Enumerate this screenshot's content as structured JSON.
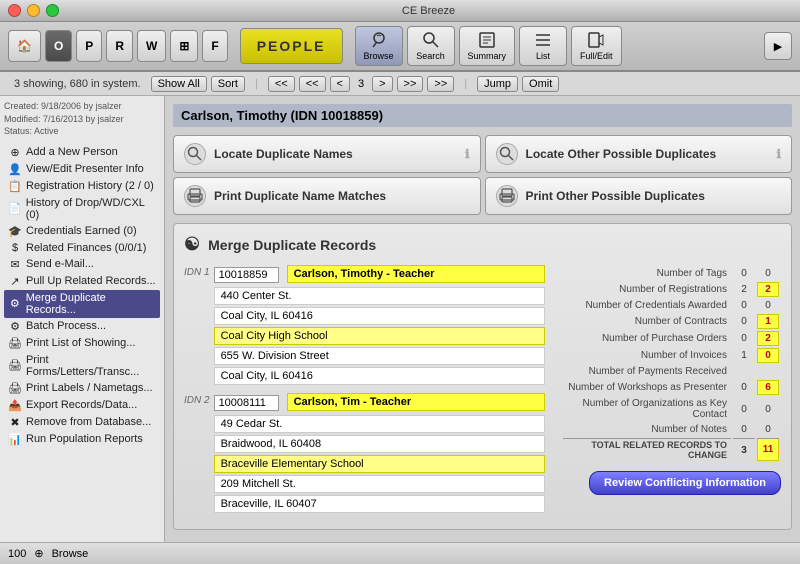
{
  "window": {
    "title": "CE Breeze"
  },
  "toolbar": {
    "people_label": "People",
    "nav_buttons": [
      "O",
      "P",
      "R",
      "W",
      "F"
    ],
    "icon_buttons": [
      {
        "label": "Browse",
        "key": "browse"
      },
      {
        "label": "Search",
        "key": "search"
      },
      {
        "label": "Summary",
        "key": "summary"
      },
      {
        "label": "List",
        "key": "list"
      },
      {
        "label": "Full/Edit",
        "key": "full_edit"
      }
    ]
  },
  "nav_bar": {
    "showing_text": "3 showing, 680 in system.",
    "show_all": "Show All",
    "sort": "Sort",
    "first": "<<",
    "prev_far": "<<",
    "prev": "<",
    "current_page": "3",
    "next": ">",
    "next_far": ">>",
    "last": ">>",
    "jump": "Jump",
    "omit": "Omit"
  },
  "sidebar": {
    "meta": {
      "created": "Created: 9/18/2006 by jsalzer",
      "modified": "Modified: 7/16/2013 by jsalzer",
      "status": "Status: Active"
    },
    "items": [
      {
        "label": "Add a New Person",
        "icon": "+",
        "key": "add-person"
      },
      {
        "label": "View/Edit Presenter Info",
        "icon": "👤",
        "key": "view-edit"
      },
      {
        "label": "Registration History (2 / 0)",
        "icon": "📋",
        "key": "reg-history"
      },
      {
        "label": "History of Drop/WD/CXL (0)",
        "icon": "📄",
        "key": "drop-history"
      },
      {
        "label": "Credentials Earned (0)",
        "icon": "🎓",
        "key": "credentials"
      },
      {
        "label": "Related Finances (0/0/1)",
        "icon": "💰",
        "key": "finances"
      },
      {
        "label": "Send e-Mail...",
        "icon": "✉",
        "key": "email"
      },
      {
        "label": "Pull Up Related Records...",
        "icon": "🔗",
        "key": "related-records"
      },
      {
        "label": "Merge Duplicate Records...",
        "icon": "⚙",
        "key": "merge-duplicate",
        "active": true
      },
      {
        "label": "Batch Process...",
        "icon": "⚙",
        "key": "batch-process"
      },
      {
        "label": "Print List of Showing...",
        "icon": "🖨",
        "key": "print-list"
      },
      {
        "label": "Print Forms/Letters/Transc...",
        "icon": "🖨",
        "key": "print-forms"
      },
      {
        "label": "Print Labels / Nametags...",
        "icon": "🖨",
        "key": "print-labels"
      },
      {
        "label": "Export Records/Data...",
        "icon": "📤",
        "key": "export-records"
      },
      {
        "label": "Remove from Database...",
        "icon": "🗑",
        "key": "remove-db"
      },
      {
        "label": "Run Population Reports",
        "icon": "📊",
        "key": "run-reports"
      }
    ]
  },
  "content": {
    "person_header": "Carlson, Timothy  (IDN 10018859)",
    "action_buttons": [
      {
        "label": "Locate Duplicate Names",
        "icon": "🔍",
        "key": "locate-dup-names"
      },
      {
        "label": "Locate Other Possible Duplicates",
        "icon": "🔍",
        "key": "locate-other-dup"
      },
      {
        "label": "Print Duplicate Name Matches",
        "icon": "🖨",
        "key": "print-dup-names"
      },
      {
        "label": "Print Other Possible Duplicates",
        "icon": "🖨",
        "key": "print-other-dup"
      }
    ],
    "merge_section": {
      "title": "Merge Duplicate Records",
      "records": [
        {
          "idn_label": "IDN 1",
          "idn_number": "10018859",
          "name": "Carlson, Timothy - Teacher",
          "address1": "440 Center St.",
          "address2": "Coal City,  IL  60416",
          "school": "Coal City High School",
          "address3": "655 W. Division Street",
          "address4": "Coal City,  IL  60416"
        },
        {
          "idn_label": "IDN 2",
          "idn_number": "10008111",
          "name": "Carlson, Tim - Teacher",
          "address1": "49 Cedar St.",
          "address2": "Braidwood,  IL  60408",
          "school": "Braceville Elementary School",
          "address3": "209 Mitchell St.",
          "address4": "Braceville,  IL  60407"
        }
      ],
      "stats": [
        {
          "label": "Number of Tags",
          "val1": "0",
          "val2": "0",
          "highlight2": false
        },
        {
          "label": "Number of Registrations",
          "val1": "2",
          "val2": "2",
          "highlight2": true
        },
        {
          "label": "Number of Credentials Awarded",
          "val1": "0",
          "val2": "0",
          "highlight2": false
        },
        {
          "label": "Number of Contracts",
          "val1": "0",
          "val2": "1",
          "highlight2": true
        },
        {
          "label": "Number of Purchase Orders",
          "val1": "0",
          "val2": "2",
          "highlight2": true
        },
        {
          "label": "Number of Invoices",
          "val1": "1",
          "val2": "0",
          "highlight2": false
        },
        {
          "label": "Number of Payments Received",
          "val1": "",
          "val2": "",
          "highlight2": false,
          "empty": true
        },
        {
          "label": "Number of Workshops as Presenter",
          "val1": "0",
          "val2": "6",
          "highlight2": true
        },
        {
          "label": "Number of Organizations as Key Contact",
          "val1": "0",
          "val2": "0",
          "highlight2": false
        },
        {
          "label": "Number of Notes",
          "val1": "0",
          "val2": "0",
          "highlight2": false
        },
        {
          "label": "TOTAL RELATED RECORDS TO CHANGE",
          "val1": "3",
          "val2": "11",
          "highlight2": true,
          "total": true
        }
      ],
      "review_button": "Review Conflicting Information"
    }
  },
  "status_bar": {
    "zoom": "100",
    "mode": "Browse"
  }
}
